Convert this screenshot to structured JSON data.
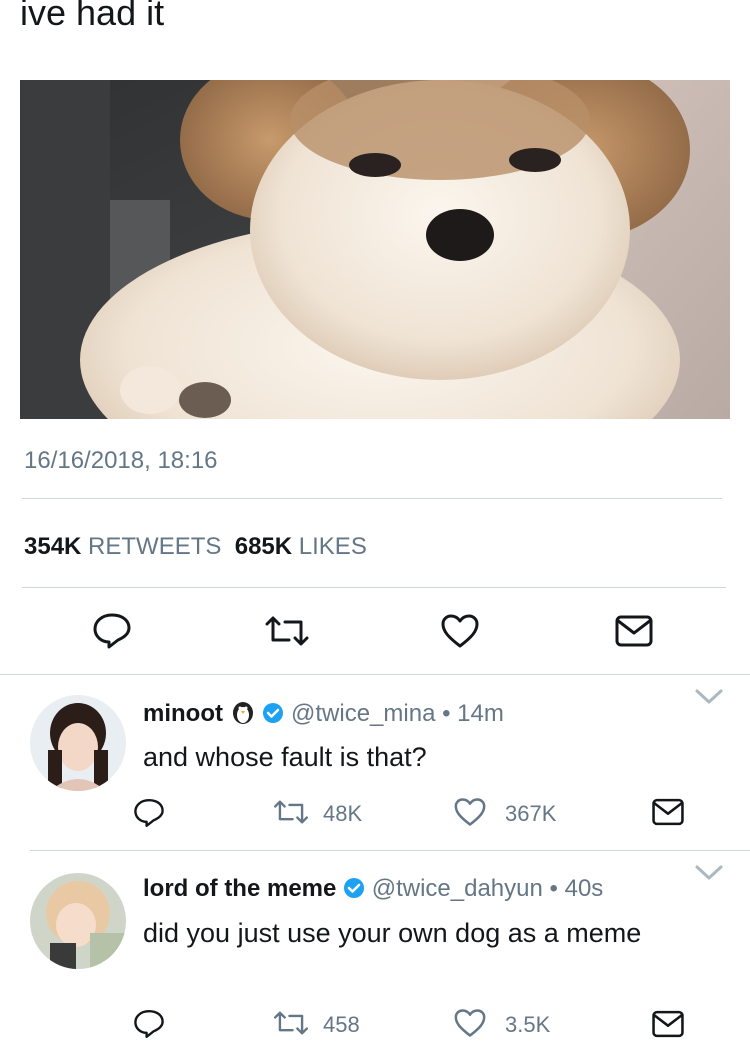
{
  "tweet": {
    "text": "ive had it",
    "timestamp": "16/16/2018, 18:16",
    "retweets_count": "354K",
    "retweets_label": "RETWEETS",
    "likes_count": "685K",
    "likes_label": "LIKES"
  },
  "replies": [
    {
      "name": "minoot",
      "handle": "@twice_mina",
      "time": "14m",
      "text": "and whose fault is that?",
      "retweets": "48K",
      "likes": "367K",
      "name_emoji": "penguin-icon",
      "verified": true
    },
    {
      "name": "lord of the meme",
      "handle": "@twice_dahyun",
      "time": "40s",
      "text": "did you just use your own dog as a meme",
      "retweets": "458",
      "likes": "3.5K",
      "verified": true
    }
  ],
  "separator": "•",
  "colors": {
    "text": "#14171a",
    "secondary": "#657786",
    "verified": "#1da1f2",
    "divider": "#d0d6db"
  }
}
